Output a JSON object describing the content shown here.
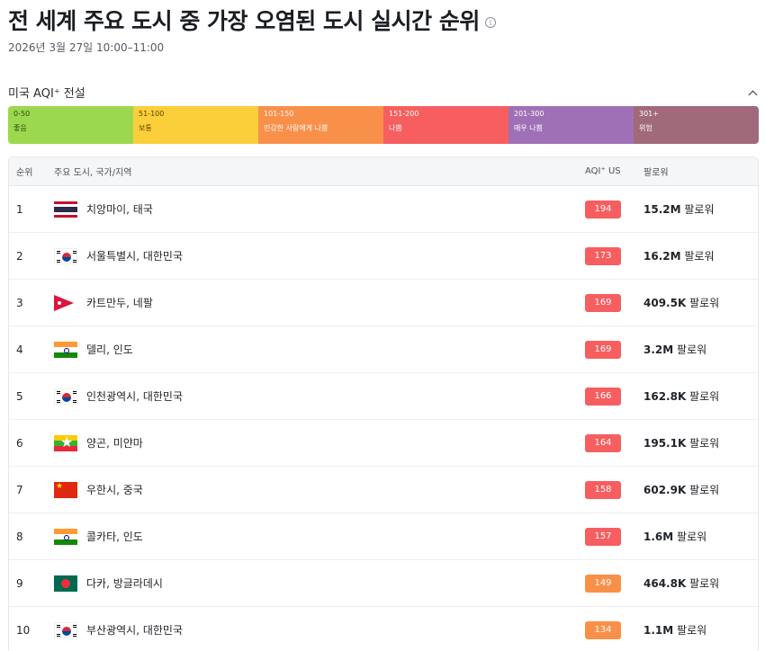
{
  "header": {
    "title": "전 세계 주요 도시 중 가장 오염된 도시 실시간 순위",
    "timestamp": "2026년 3월 27일 10:00–11:00"
  },
  "legend": {
    "title": "미국 AQI⁺ 전설",
    "segments": [
      {
        "range": "0-50",
        "label": "좋음",
        "color": "#9cd84e"
      },
      {
        "range": "51-100",
        "label": "보통",
        "color": "#facf39"
      },
      {
        "range": "101-150",
        "label": "민감한 사람에게 나쁨",
        "color": "#f99049"
      },
      {
        "range": "151-200",
        "label": "나쁨",
        "color": "#f65e5f"
      },
      {
        "range": "201-300",
        "label": "매우 나쁨",
        "color": "#a070b6"
      },
      {
        "range": "301+",
        "label": "위험",
        "color": "#a06a7b"
      }
    ]
  },
  "table": {
    "headers": {
      "rank": "순위",
      "city": "주요 도시, 국가/지역",
      "aqi": "AQI⁺ US",
      "followers": "팔로워"
    },
    "follow_suffix": "팔로워",
    "rows": [
      {
        "rank": "1",
        "flag": "thailand-flag-icon",
        "city": "치앙마이, 태국",
        "aqi": "194",
        "color": "#f65e5f",
        "followers": "15.2M"
      },
      {
        "rank": "2",
        "flag": "south-korea-flag-icon",
        "city": "서울특별시, 대한민국",
        "aqi": "173",
        "color": "#f65e5f",
        "followers": "16.2M"
      },
      {
        "rank": "3",
        "flag": "nepal-flag-icon",
        "city": "카트만두, 네팔",
        "aqi": "169",
        "color": "#f65e5f",
        "followers": "409.5K"
      },
      {
        "rank": "4",
        "flag": "india-flag-icon",
        "city": "델리, 인도",
        "aqi": "169",
        "color": "#f65e5f",
        "followers": "3.2M"
      },
      {
        "rank": "5",
        "flag": "south-korea-flag-icon",
        "city": "인천광역시, 대한민국",
        "aqi": "166",
        "color": "#f65e5f",
        "followers": "162.8K"
      },
      {
        "rank": "6",
        "flag": "myanmar-flag-icon",
        "city": "양곤, 미얀마",
        "aqi": "164",
        "color": "#f65e5f",
        "followers": "195.1K"
      },
      {
        "rank": "7",
        "flag": "china-flag-icon",
        "city": "우한시, 중국",
        "aqi": "158",
        "color": "#f65e5f",
        "followers": "602.9K"
      },
      {
        "rank": "8",
        "flag": "india-flag-icon",
        "city": "콜카타, 인도",
        "aqi": "157",
        "color": "#f65e5f",
        "followers": "1.6M"
      },
      {
        "rank": "9",
        "flag": "bangladesh-flag-icon",
        "city": "다카, 방글라데시",
        "aqi": "149",
        "color": "#f99049",
        "followers": "464.8K"
      },
      {
        "rank": "10",
        "flag": "south-korea-flag-icon",
        "city": "부산광역시, 대한민국",
        "aqi": "134",
        "color": "#f99049",
        "followers": "1.1M"
      }
    ]
  }
}
